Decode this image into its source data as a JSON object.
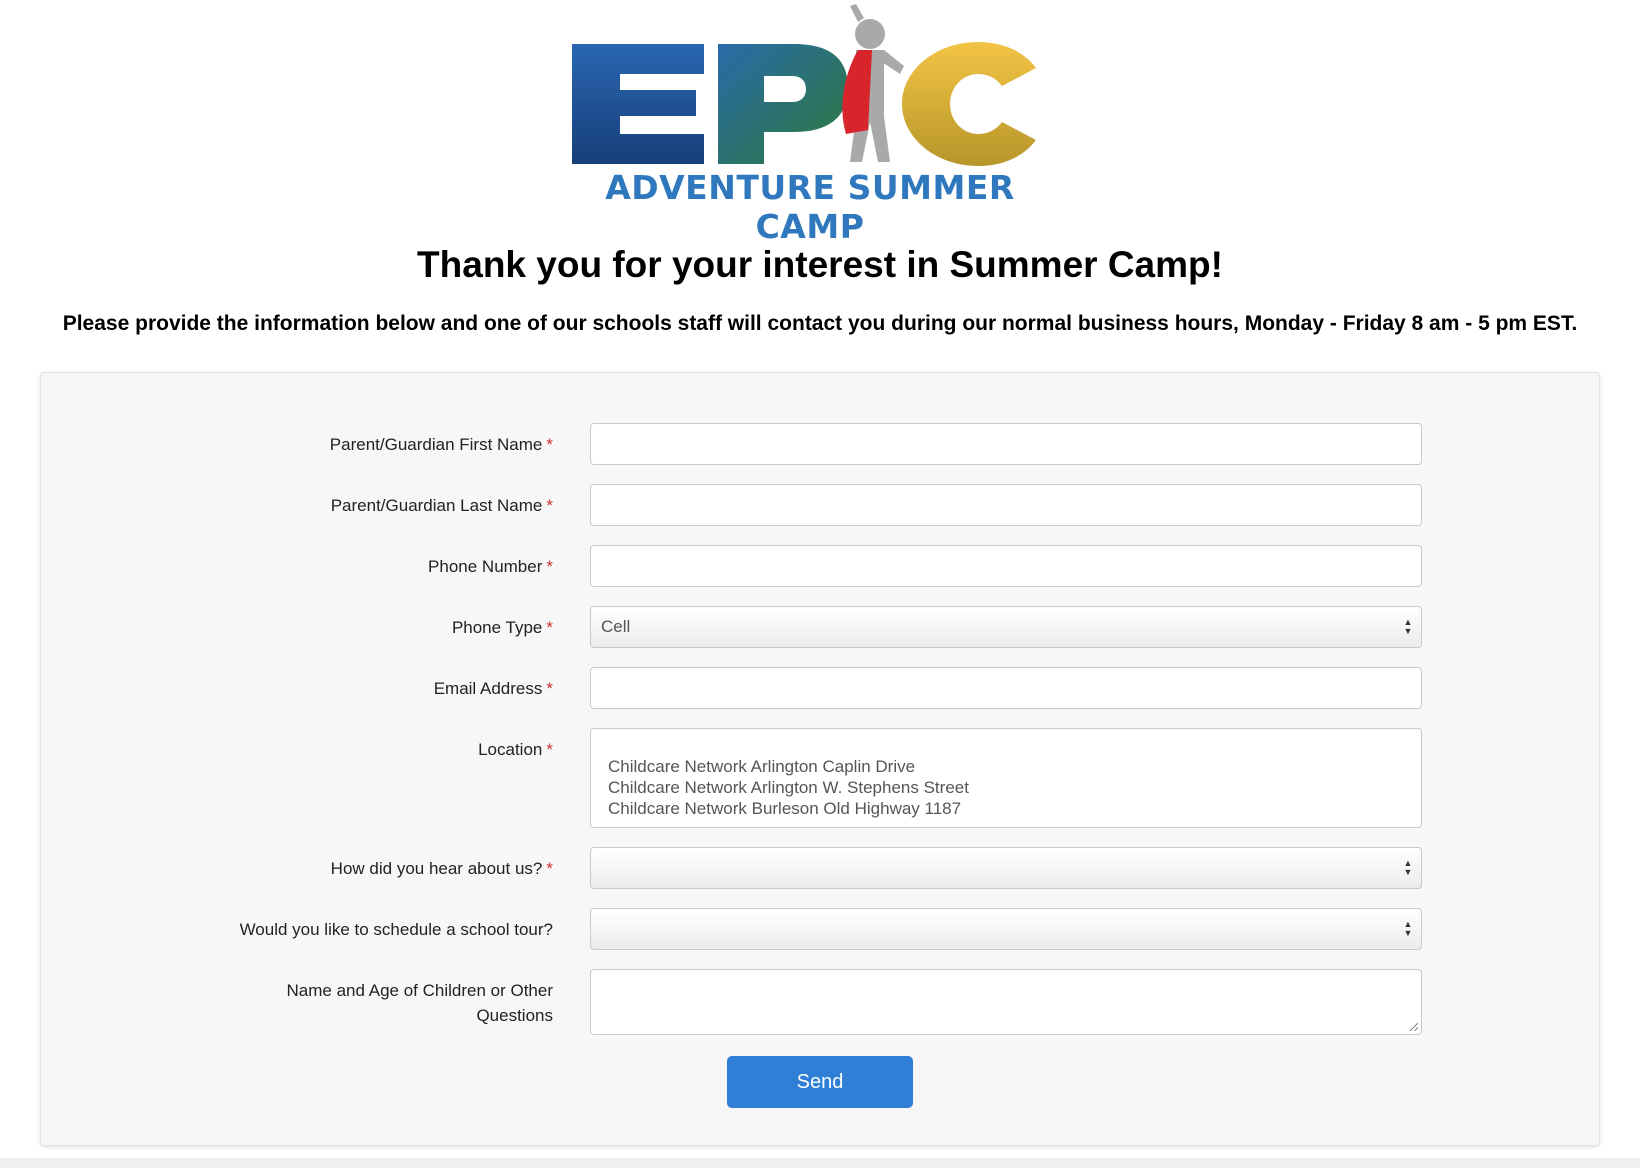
{
  "logo": {
    "wordmark": "EPIC",
    "subtitle": "ADVENTURE SUMMER CAMP"
  },
  "headline": "Thank you for your interest in Summer Camp!",
  "intro": "Please provide the information below and one of our schools staff will contact you during our normal business hours, Monday - Friday 8 am - 5 pm EST.",
  "required_marker": "*",
  "form": {
    "first_name": {
      "label": "Parent/Guardian First Name",
      "value": ""
    },
    "last_name": {
      "label": "Parent/Guardian Last Name",
      "value": ""
    },
    "phone": {
      "label": "Phone Number",
      "value": ""
    },
    "phone_type": {
      "label": "Phone Type",
      "value": "Cell"
    },
    "email": {
      "label": "Email Address",
      "value": ""
    },
    "location": {
      "label": "Location",
      "options": [
        "Childcare Network Arlington Caplin Drive",
        "Childcare Network Arlington W. Stephens Street",
        "Childcare Network Burleson Old Highway 1187"
      ]
    },
    "heard_about": {
      "label": "How did you hear about us?",
      "value": ""
    },
    "tour": {
      "label": "Would you like to schedule a school tour?",
      "value": ""
    },
    "children": {
      "label": "Name and Age of Children or Other Questions",
      "value": ""
    },
    "send_label": "Send"
  },
  "colors": {
    "logo_blue": "#1f5aa0",
    "logo_green": "#3c7a3a",
    "logo_gold": "#e9bd3a",
    "cape_red": "#d8242b",
    "subtitle_blue": "#2f78bd",
    "button_blue": "#2f7fd6",
    "required_red": "#d0312d"
  }
}
